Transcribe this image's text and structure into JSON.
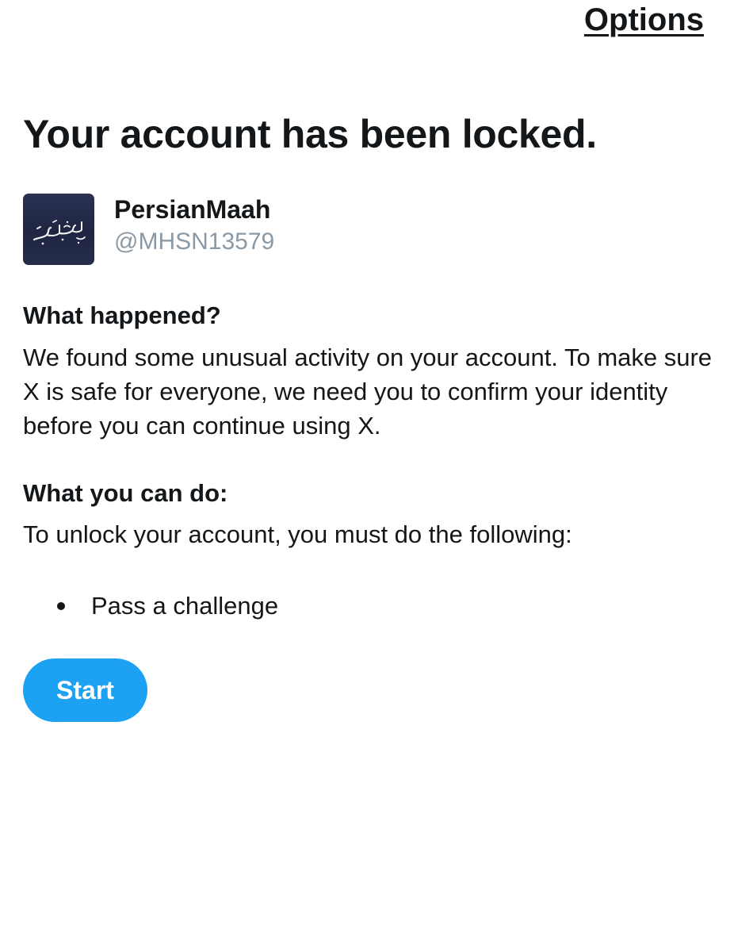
{
  "header": {
    "options_label": "Options"
  },
  "title": "Your account has been locked.",
  "account": {
    "display_name": "PersianMaah",
    "handle": "@MHSN13579",
    "avatar_icon": "calligraphy-logo-avatar",
    "avatar_text": "ساعت شاه"
  },
  "what_happened": {
    "heading": "What happened?",
    "body": "We found some unusual activity on your account. To make sure X is safe for everyone, we need you to confirm your identity before you can continue using X."
  },
  "what_you_can_do": {
    "heading": "What you can do:",
    "body": "To unlock your account, you must do the following:",
    "steps": [
      "Pass a challenge"
    ]
  },
  "actions": {
    "start_label": "Start"
  },
  "colors": {
    "primary_button": "#1da1f2",
    "text": "#14171a",
    "secondary_text": "#8a99a6",
    "avatar_bg": "#262d4a"
  }
}
